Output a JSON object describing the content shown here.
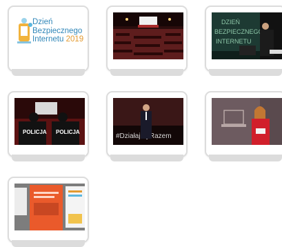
{
  "colors": {
    "logo_blue": "#2f86b8",
    "logo_orange": "#e39a30",
    "card_border": "#dcdcdc"
  },
  "gallery": {
    "logo": {
      "line1": "Dzień",
      "line2": "Bezpiecznego",
      "line3": "Internetu",
      "year": "2019"
    },
    "photos": [
      {
        "id": "photo-auditorium"
      },
      {
        "id": "photo-presenter-screen",
        "screen_text": [
          "DZIEŃ",
          "BEZPIECZNEGO",
          "INTERNETU"
        ]
      },
      {
        "id": "photo-police",
        "caption_left": "POLICJA",
        "caption_right": "POLICJA"
      },
      {
        "id": "photo-speaker",
        "banner": "#DziałajmyRazem"
      },
      {
        "id": "photo-woman-speaker"
      },
      {
        "id": "photo-posters"
      }
    ]
  }
}
